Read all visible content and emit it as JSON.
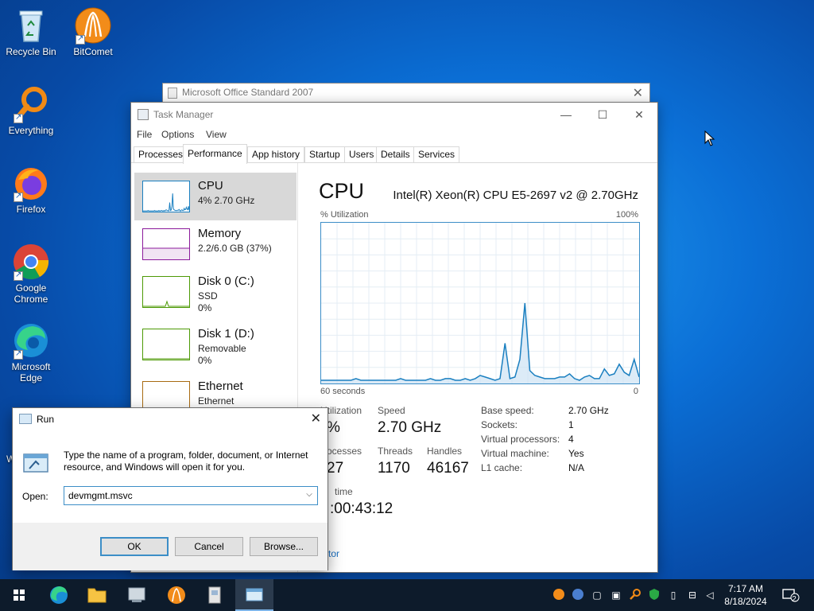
{
  "desktop": {
    "icons": [
      {
        "label": "Recycle Bin"
      },
      {
        "label": "BitComet"
      },
      {
        "label": "Everything"
      },
      {
        "label": "Firefox"
      },
      {
        "label": "Google Chrome"
      },
      {
        "label": "Microsoft Edge"
      }
    ],
    "partial_label": "W"
  },
  "office_window": {
    "title": "Microsoft Office Standard 2007"
  },
  "task_manager": {
    "title": "Task Manager",
    "menu": [
      "File",
      "Options",
      "View"
    ],
    "tabs": [
      "Processes",
      "Performance",
      "App history",
      "Startup",
      "Users",
      "Details",
      "Services"
    ],
    "active_tab": "Performance",
    "sidebar": [
      {
        "name": "CPU",
        "line1": "4% 2.70 GHz",
        "line2": "",
        "color": "#1a7fc0"
      },
      {
        "name": "Memory",
        "line1": "2.2/6.0 GB (37%)",
        "line2": "",
        "color": "#8b1a9b"
      },
      {
        "name": "Disk 0 (C:)",
        "line1": "SSD",
        "line2": "0%",
        "color": "#4d9a06"
      },
      {
        "name": "Disk 1 (D:)",
        "line1": "Removable",
        "line2": "0%",
        "color": "#4d9a06"
      },
      {
        "name": "Ethernet",
        "line1": "Ethernet",
        "line2": "",
        "color": "#a86b12"
      }
    ],
    "main": {
      "title": "CPU",
      "cpu_model": "Intel(R) Xeon(R) CPU E5-2697 v2 @ 2.70GHz",
      "util_label": "% Utilization",
      "max_label": "100%",
      "time_label": "60 seconds",
      "zero_label": "0",
      "graph_values": [
        2,
        2,
        2,
        2,
        2,
        2,
        2,
        3,
        2,
        2,
        2,
        2,
        2,
        2,
        2,
        2,
        3,
        2,
        2,
        2,
        2,
        2,
        3,
        2,
        2,
        3,
        3,
        2,
        2,
        3,
        2,
        3,
        5,
        4,
        3,
        2,
        3,
        25,
        3,
        4,
        15,
        50,
        8,
        5,
        4,
        3,
        3,
        3,
        4,
        4,
        6,
        3,
        2,
        4,
        5,
        3,
        3,
        9,
        5,
        6,
        12,
        7,
        5,
        15,
        4
      ],
      "stats": {
        "utilization_label": "Utilization",
        "utilization_value": "%",
        "speed_label": "Speed",
        "speed_value": "2.70 GHz",
        "processes_label": "ocesses",
        "processes_value": "27",
        "threads_label": "Threads",
        "threads_value": "1170",
        "handles_label": "Handles",
        "handles_value": "46167",
        "uptime_label": "time",
        "uptime_value": ":00:43:12",
        "monitor_link": "tor"
      },
      "details": [
        {
          "k": "Base speed:",
          "v": "2.70 GHz"
        },
        {
          "k": "Sockets:",
          "v": "1"
        },
        {
          "k": "Virtual processors:",
          "v": "4"
        },
        {
          "k": "Virtual machine:",
          "v": "Yes"
        },
        {
          "k": "L1 cache:",
          "v": "N/A"
        }
      ]
    }
  },
  "run_dialog": {
    "title": "Run",
    "description": "Type the name of a program, folder, document, or Internet resource, and Windows will open it for you.",
    "open_label": "Open:",
    "input_value": "devmgmt.msvc",
    "ok": "OK",
    "cancel": "Cancel",
    "browse": "Browse..."
  },
  "taskbar": {
    "time": "7:17 AM",
    "date": "8/18/2024",
    "notifications": "2"
  }
}
